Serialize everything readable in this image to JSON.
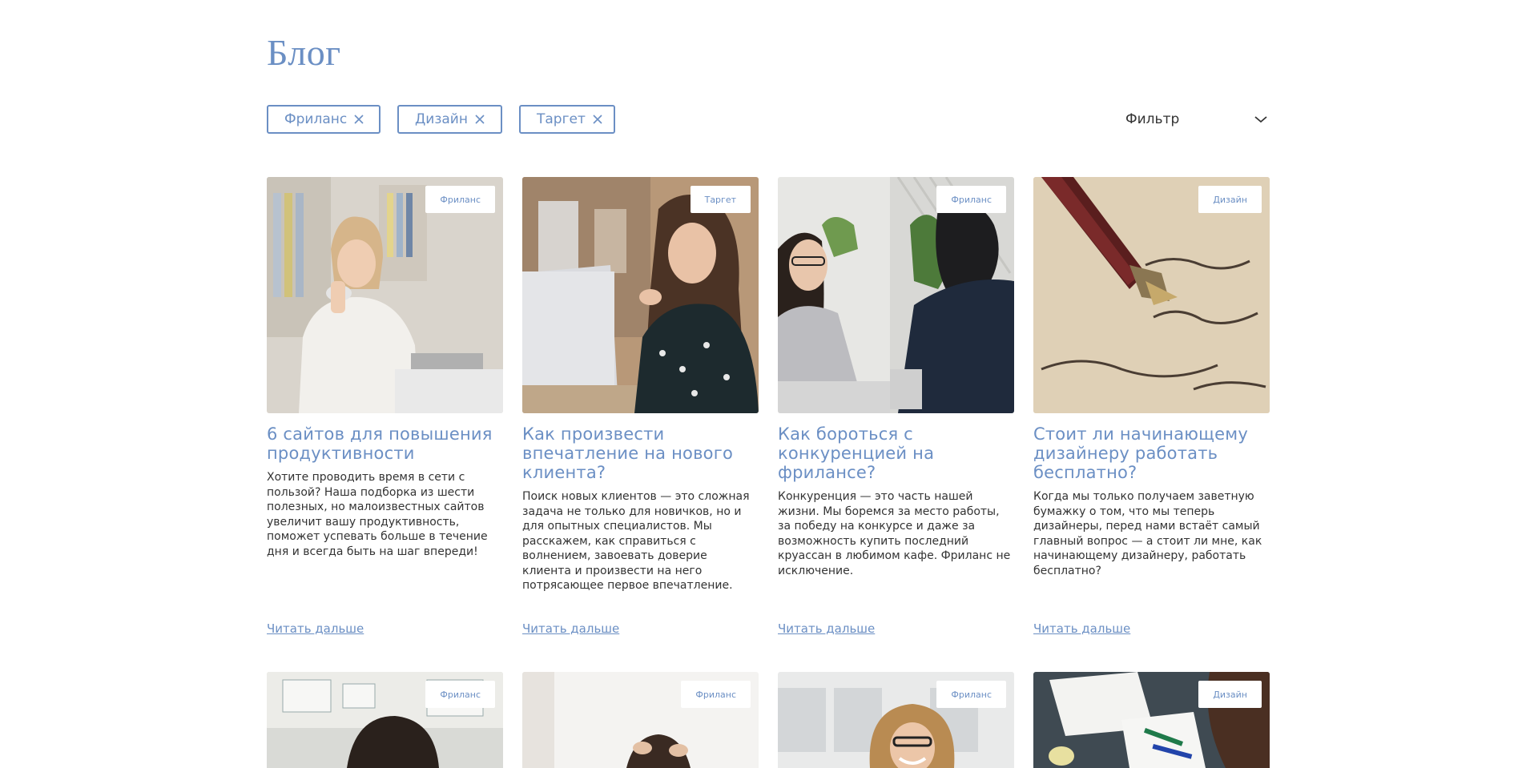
{
  "title": "Блог",
  "filters": {
    "chips": [
      {
        "label": "Фриланс"
      },
      {
        "label": "Дизайн"
      },
      {
        "label": "Таргет"
      }
    ],
    "dropdown_label": "Фильтр"
  },
  "posts": [
    {
      "tag": "Фриланс",
      "title": "6 сайтов для повышения продуктивности",
      "excerpt": "Хотите проводить время в сети с пользой? Наша подборка из шести полезных, но малоизвестных сайтов увеличит вашу продуктивность, поможет успевать больше в течение дня и всегда быть на шаг впереди!",
      "link": "Читать дальше",
      "image": "woman-thumbs-up-photo"
    },
    {
      "tag": "Таргет",
      "title": "Как произвести впечатление на нового клиента?",
      "excerpt": "Поиск новых клиентов — это сложная задача не только для новичков, но и для опытных специалистов. Мы расскажем, как справиться с волнением, завоевать доверие клиента и произвести на него потрясающее первое впечатление.",
      "link": "Читать дальше",
      "image": "woman-laptop-photo"
    },
    {
      "tag": "Фриланс",
      "title": "Как бороться с конкуренцией на фрилансе?",
      "excerpt": "Конкуренция — это часть нашей жизни. Мы боремся за место работы, за победу на конкурсе и даже за возможность купить последний круассан в любимом кафе. Фриланс не исключение.",
      "link": "Читать дальше",
      "image": "interview-photo"
    },
    {
      "tag": "Дизайн",
      "title": "Стоит ли начинающему дизайнеру работать бесплатно?",
      "excerpt": "Когда мы только получаем заветную бумажку о том, что мы теперь дизайнеры, перед нами встаёт самый главный вопрос — а стоит ли мне, как начинающему дизайнеру, работать бесплатно?",
      "link": "Читать дальше",
      "image": "fountain-pen-photo"
    }
  ],
  "posts_row2": [
    {
      "tag": "Фриланс",
      "image": "whiteboard-photo"
    },
    {
      "tag": "Фриланс",
      "image": "stressed-person-photo"
    },
    {
      "tag": "Фриланс",
      "image": "smiling-woman-glasses-photo"
    },
    {
      "tag": "Дизайн",
      "image": "drawing-desk-photo"
    }
  ],
  "colors": {
    "accent": "#6b8fc4",
    "text": "#333333",
    "background": "#ffffff"
  }
}
